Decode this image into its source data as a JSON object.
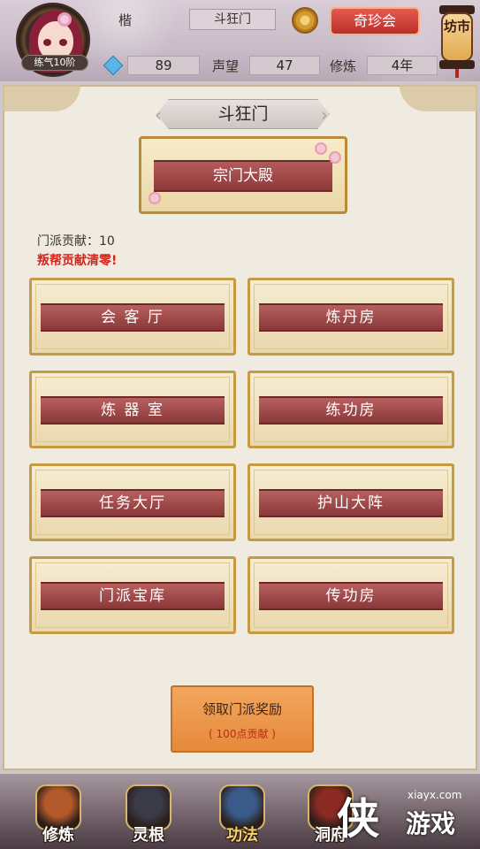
{
  "player": {
    "name": "楷",
    "level": "练气10阶",
    "sect": "斗狂门",
    "spirit_stones": "89",
    "reputation_label": "声望",
    "reputation": "47",
    "cultivation_label": "修炼",
    "cultivation": "4年"
  },
  "header": {
    "treasure_button": "奇珍会",
    "market_label": "坊市"
  },
  "panel": {
    "title": "斗狂门",
    "main_hall": "宗门大殿",
    "contribution_text": "门派贡献：10",
    "warning_text": "叛帮贡献清零!",
    "rooms": [
      "会 客 厅",
      "炼丹房",
      "炼 器 室",
      "练功房",
      "任务大厅",
      "护山大阵",
      "门派宝库",
      "传功房"
    ],
    "reward_button": "领取门派奖励",
    "reward_cost": "( 100点贡献 )"
  },
  "nav": {
    "items": [
      "修炼",
      "灵根",
      "功法",
      "洞府"
    ],
    "active": "功法",
    "icon_colors": [
      "#b45a2a",
      "#3b3b48",
      "#3a5b8a",
      "#8a2a22"
    ]
  },
  "watermark": {
    "glyph": "侠",
    "site": "xiayx.com",
    "text": "游戏"
  }
}
